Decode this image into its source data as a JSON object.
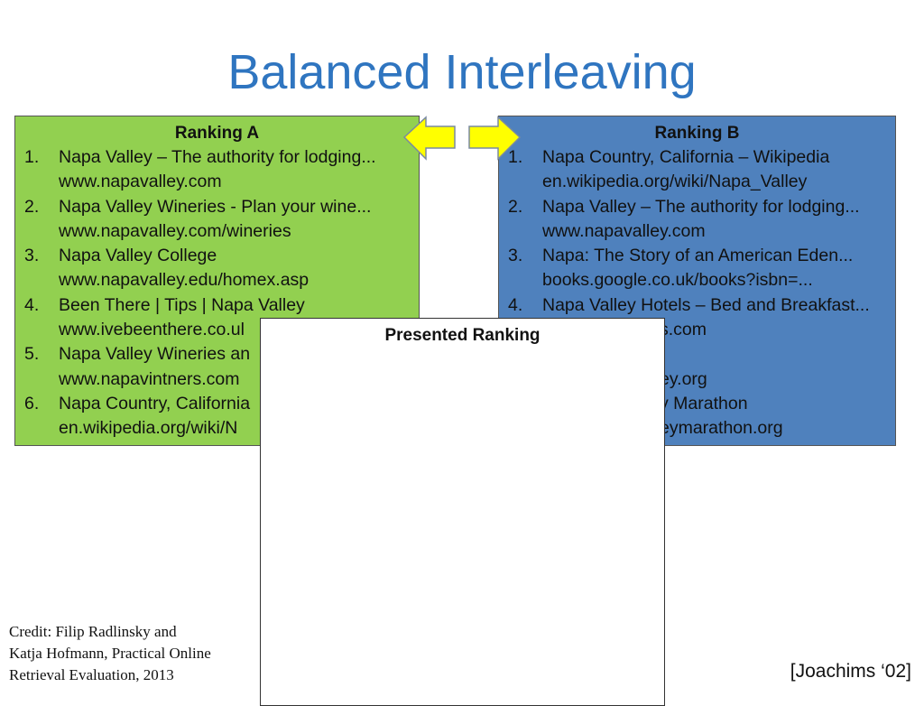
{
  "title": "Balanced Interleaving",
  "ranking_a": {
    "heading": "Ranking A",
    "color": "#92d050",
    "items": [
      {
        "num": "1.",
        "title": "Napa Valley – The authority for lodging...",
        "url": "www.napavalley.com"
      },
      {
        "num": "2.",
        "title": "Napa Valley Wineries - Plan your wine...",
        "url": "www.napavalley.com/wineries"
      },
      {
        "num": "3.",
        "title": "Napa Valley College",
        "url": "www.napavalley.edu/homex.asp"
      },
      {
        "num": "4.",
        "title": "Been There | Tips | Napa Valley",
        "url": "www.ivebeenthere.co.ul"
      },
      {
        "num": "5.",
        "title": "Napa Valley Wineries an",
        "url": "www.napavintners.com"
      },
      {
        "num": "6.",
        "title": "Napa Country, California",
        "url": "en.wikipedia.org/wiki/N"
      }
    ]
  },
  "ranking_b": {
    "heading": "Ranking B",
    "color": "#4f81bd",
    "items": [
      {
        "num": "1.",
        "title": "Napa Country, California – Wikipedia",
        "url": "en.wikipedia.org/wiki/Napa_Valley"
      },
      {
        "num": "2.",
        "title": "Napa Valley – The authority for lodging...",
        "url": "www.napavalley.com"
      },
      {
        "num": "3.",
        "title": "Napa: The Story of an American Eden...",
        "url": "books.google.co.uk/books?isbn=..."
      },
      {
        "num": "4.",
        "title": "Napa Valley Hotels – Bed and Breakfast...",
        "url": "s.com"
      },
      {
        "num": "",
        "title": "",
        "url": "ey.org"
      },
      {
        "num": "",
        "title": "y Marathon",
        "url": "eymarathon.org"
      }
    ]
  },
  "presented": {
    "heading": "Presented Ranking"
  },
  "arrows": {
    "color": "#ffff00",
    "left_icon": "arrow-left-icon",
    "right_icon": "arrow-right-icon"
  },
  "credit": {
    "line1": "Credit: Filip Radlinsky and",
    "line2": "Katja Hofmann, Practical Online",
    "line3": "Retrieval Evaluation, 2013"
  },
  "citation": "[Joachims ‘02]"
}
